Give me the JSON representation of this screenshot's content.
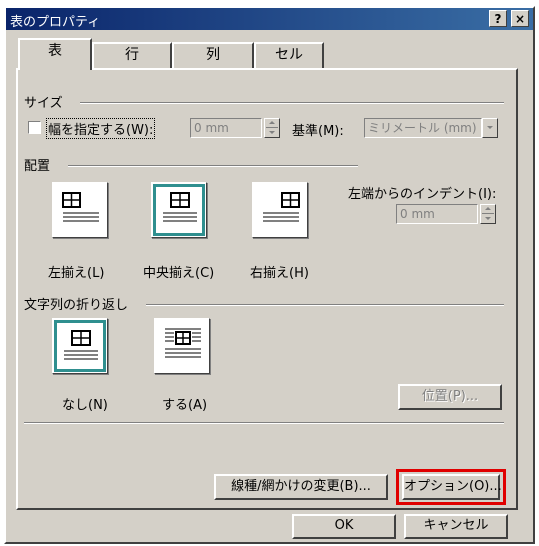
{
  "window": {
    "title": "表のプロパティ",
    "help_label": "?",
    "close_label": "×"
  },
  "tabs": [
    {
      "label": "表",
      "active": true
    },
    {
      "label": "行",
      "active": false
    },
    {
      "label": "列",
      "active": false
    },
    {
      "label": "セル",
      "active": false
    }
  ],
  "size": {
    "heading": "サイズ",
    "width_checkbox_label": "幅を指定する(W):",
    "width_value": "0 mm",
    "basis_label": "基準(M):",
    "basis_value": "ミリメートル (mm)"
  },
  "alignment": {
    "heading": "配置",
    "options": [
      {
        "label": "左揃え(L)",
        "selected": false,
        "icon": "table-align-left-icon"
      },
      {
        "label": "中央揃え(C)",
        "selected": true,
        "icon": "table-align-center-icon"
      },
      {
        "label": "右揃え(H)",
        "selected": false,
        "icon": "table-align-right-icon"
      }
    ],
    "indent_label": "左端からのインデント(I):",
    "indent_value": "0 mm"
  },
  "wrapping": {
    "heading": "文字列の折り返し",
    "options": [
      {
        "label": "なし(N)",
        "selected": true,
        "icon": "wrap-none-icon"
      },
      {
        "label": "する(A)",
        "selected": false,
        "icon": "wrap-around-icon"
      }
    ],
    "position_button": "位置(P)..."
  },
  "buttons": {
    "borders": "線種/網かけの変更(B)...",
    "options": "オプション(O)...",
    "ok": "OK",
    "cancel": "キャンセル"
  },
  "highlight_color": "#e00000",
  "selection_color": "#2f8f8f"
}
